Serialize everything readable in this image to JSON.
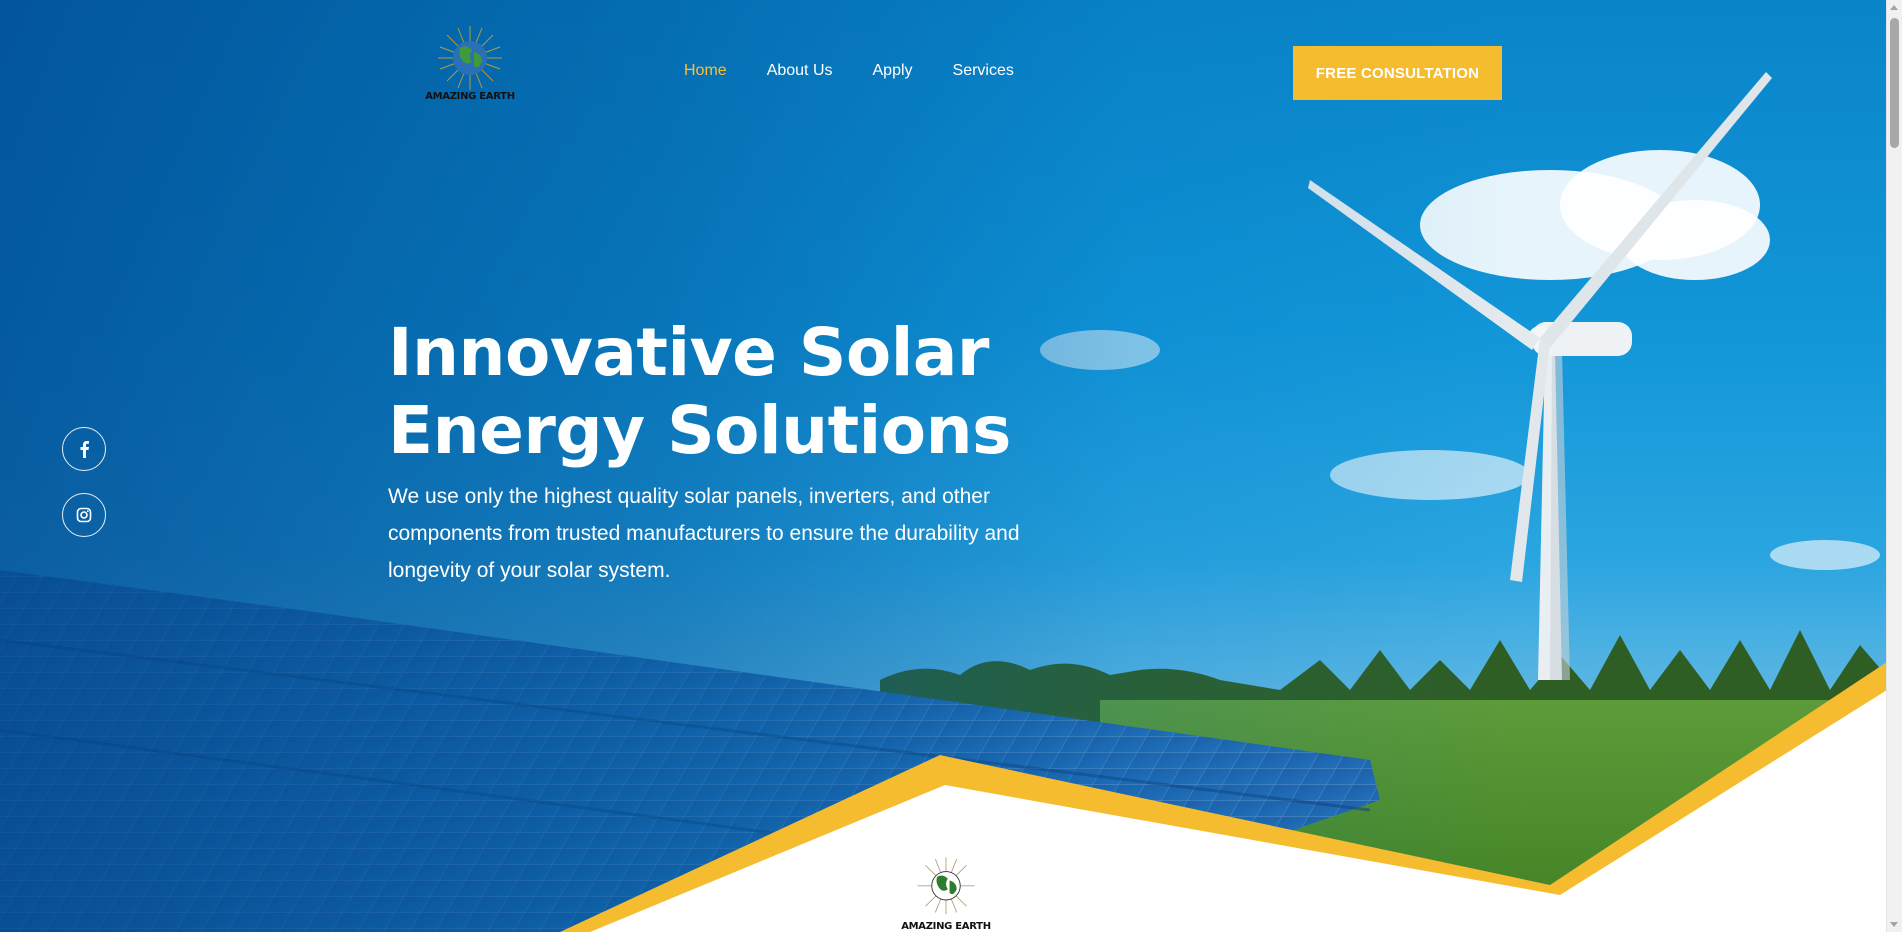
{
  "brand": {
    "logo_text": "AMAZING EARTH",
    "colors": {
      "accent": "#f6bc30",
      "nav_active": "#f6c038",
      "sky": "#1196d8",
      "white": "#ffffff"
    }
  },
  "nav": {
    "items": [
      {
        "label": "Home",
        "active": true
      },
      {
        "label": "About Us",
        "active": false
      },
      {
        "label": "Apply",
        "active": false
      },
      {
        "label": "Services",
        "active": false
      }
    ]
  },
  "cta": {
    "label": "FREE CONSULTATION"
  },
  "social": [
    {
      "icon": "facebook-icon"
    },
    {
      "icon": "instagram-icon"
    }
  ],
  "hero": {
    "title_line1": "Innovative Solar",
    "title_line2": "Energy Solutions",
    "description": "We use only the highest quality solar panels, inverters, and other components from trusted manufacturers to ensure the durability and longevity of your solar system."
  },
  "bottom_logo": {
    "text": "AMAZING EARTH"
  }
}
